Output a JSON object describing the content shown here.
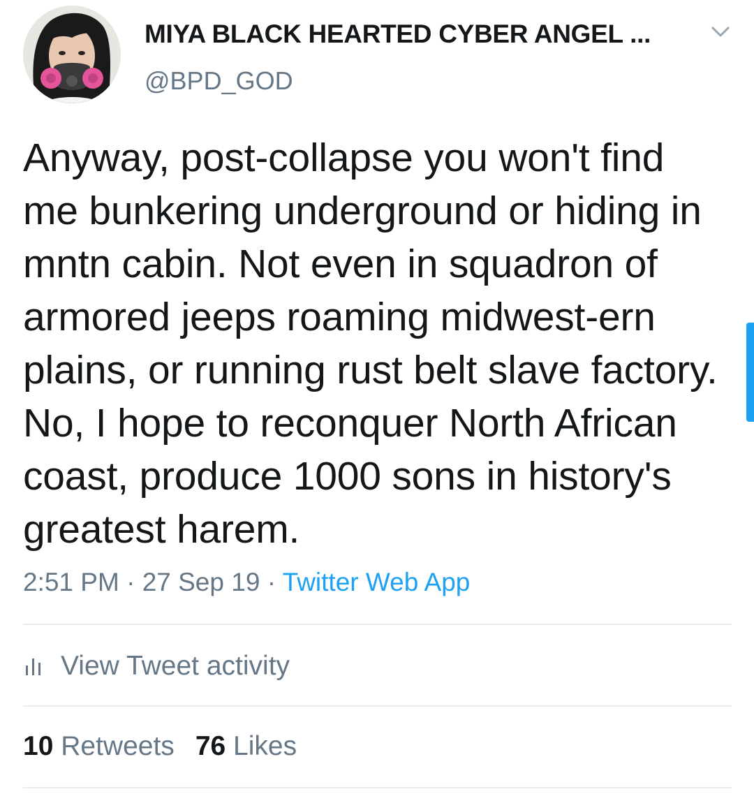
{
  "author": {
    "display_name": "MIYA BLACK HEARTED CYBER ANGEL ...",
    "handle": "@BPD_GOD",
    "avatar_icon": "avatar-woman-with-respirator-mask"
  },
  "tweet": {
    "text": "Anyway, post-collapse you won't find me bunkering underground or hiding in mntn cabin. Not even in squadron of armored jeeps roaming midwest-ern plains, or running rust belt slave factory. No, I hope to reconquer North African coast, produce 1000 sons in history's greatest harem.",
    "time": "2:51 PM",
    "date": "27 Sep 19",
    "separator": "·",
    "source": "Twitter Web App"
  },
  "activity": {
    "label": "View Tweet activity",
    "icon": "bar-chart-icon"
  },
  "stats": {
    "retweets_count": "10",
    "retweets_label": "Retweets",
    "likes_count": "76",
    "likes_label": "Likes"
  },
  "colors": {
    "text": "#14171a",
    "secondary": "#657786",
    "link": "#1da1f2",
    "divider": "#e6ecf0"
  }
}
